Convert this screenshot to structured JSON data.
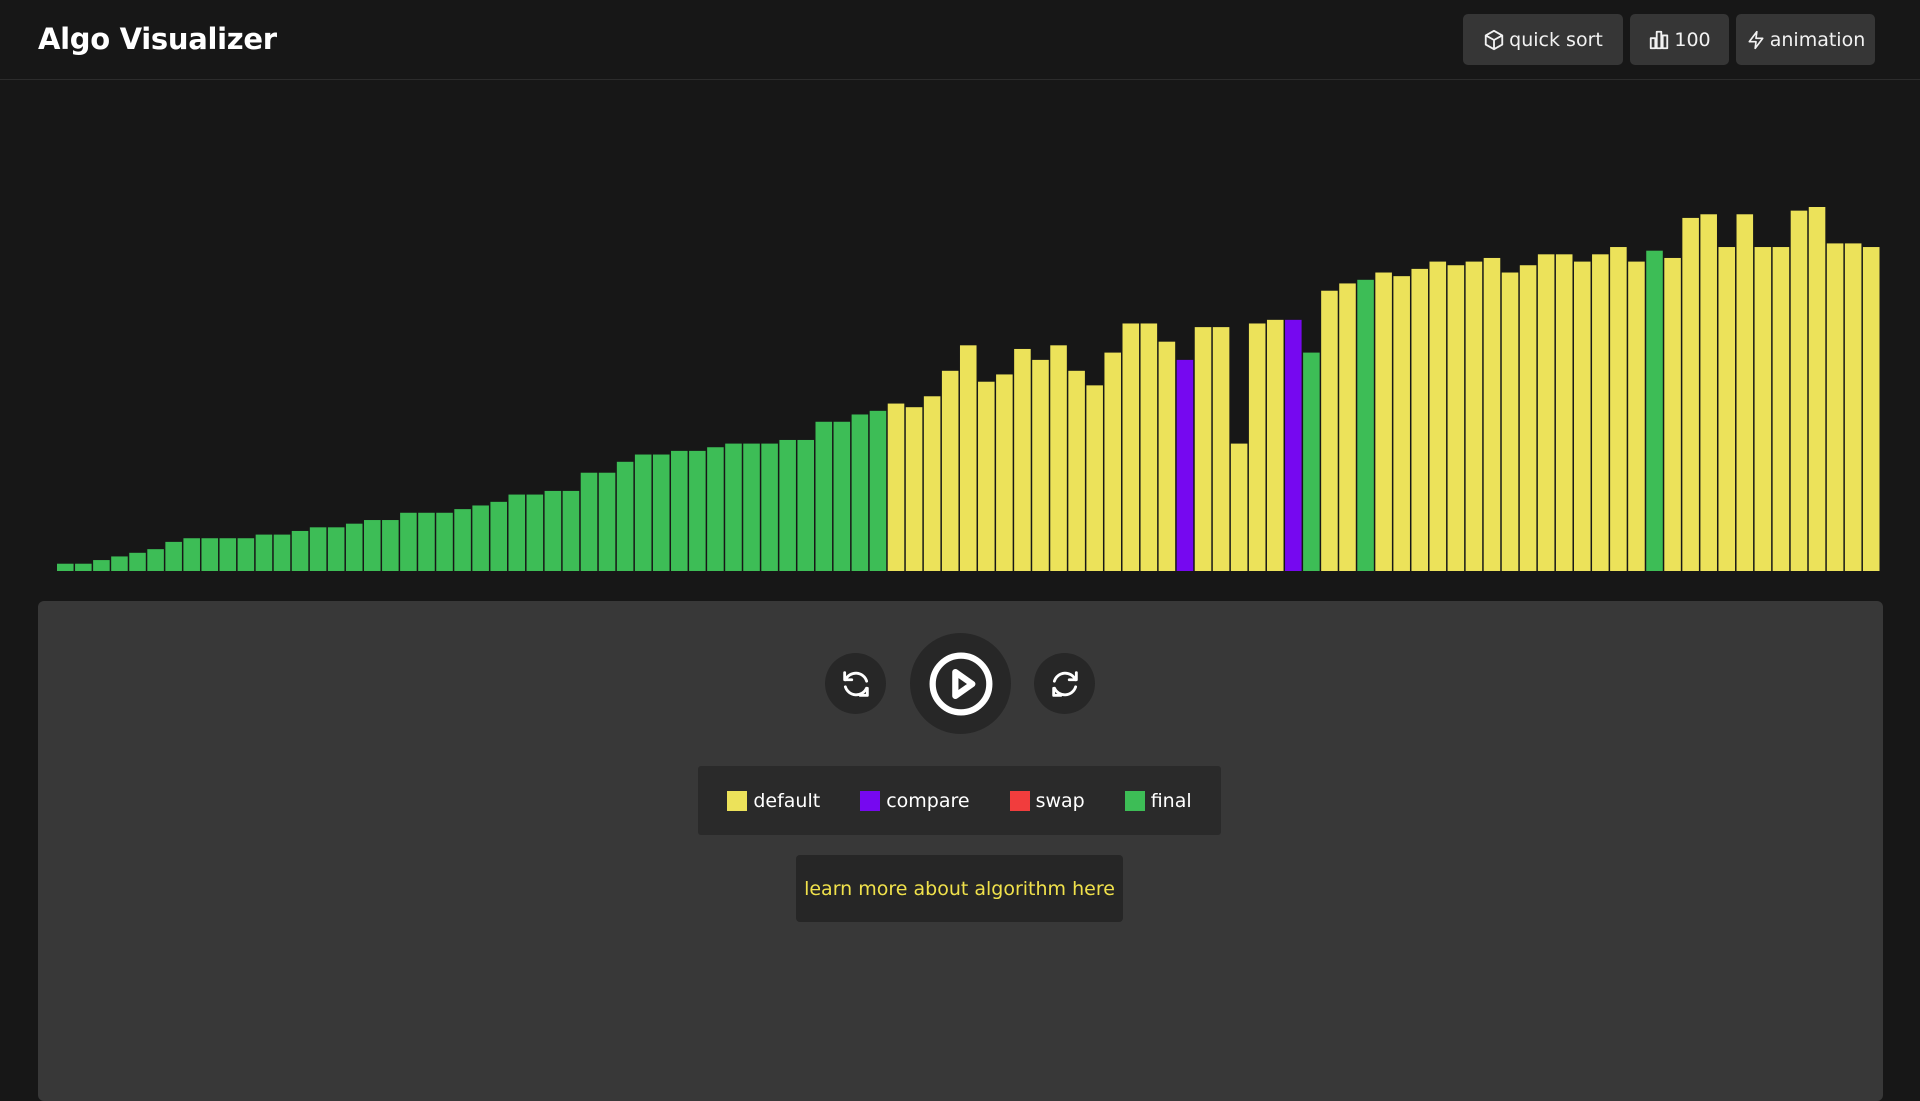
{
  "app": {
    "title": "Algo Visualizer"
  },
  "toolbar": {
    "algorithm_label": "quick sort",
    "algorithm_icon": "cube-icon",
    "array_size_label": "100",
    "array_size_icon": "bar-chart-icon",
    "speed_label": "animation",
    "speed_icon": "lightning-icon"
  },
  "controls": {
    "prev_icon": "rotate-ccw-icon",
    "play_icon": "play-circle-icon",
    "next_icon": "rotate-cw-icon"
  },
  "legend": [
    {
      "label": "default",
      "color": "#ece25a"
    },
    {
      "label": "compare",
      "color": "#7608f0"
    },
    {
      "label": "swap",
      "color": "#f13d3d"
    },
    {
      "label": "final",
      "color": "#3dbd56"
    }
  ],
  "learn_link": "learn more about algorithm here",
  "chart_data": {
    "type": "bar",
    "ylim": [
      0,
      100
    ],
    "values": [
      2,
      2,
      3,
      4,
      5,
      6,
      8,
      9,
      9,
      9,
      9,
      10,
      10,
      11,
      12,
      12,
      13,
      14,
      14,
      16,
      16,
      16,
      17,
      18,
      19,
      21,
      21,
      22,
      22,
      27,
      27,
      30,
      32,
      32,
      33,
      33,
      34,
      35,
      35,
      35,
      36,
      36,
      41,
      41,
      43,
      44,
      46,
      45,
      48,
      55,
      62,
      52,
      54,
      61,
      58,
      62,
      55,
      51,
      60,
      68,
      68,
      63,
      58,
      67,
      67,
      35,
      68,
      69,
      69,
      60,
      77,
      79,
      80,
      82,
      81,
      83,
      85,
      84,
      85,
      86,
      82,
      84,
      87,
      87,
      85,
      87,
      89,
      85,
      88,
      86,
      97,
      98,
      89,
      98,
      89,
      89,
      99,
      100,
      90,
      90,
      89
    ],
    "states": [
      "final",
      "final",
      "final",
      "final",
      "final",
      "final",
      "final",
      "final",
      "final",
      "final",
      "final",
      "final",
      "final",
      "final",
      "final",
      "final",
      "final",
      "final",
      "final",
      "final",
      "final",
      "final",
      "final",
      "final",
      "final",
      "final",
      "final",
      "final",
      "final",
      "final",
      "final",
      "final",
      "final",
      "final",
      "final",
      "final",
      "final",
      "final",
      "final",
      "final",
      "final",
      "final",
      "final",
      "final",
      "final",
      "final",
      "default",
      "default",
      "default",
      "default",
      "default",
      "default",
      "default",
      "default",
      "default",
      "default",
      "default",
      "default",
      "default",
      "default",
      "default",
      "default",
      "compare",
      "default",
      "default",
      "default",
      "default",
      "default",
      "compare",
      "final",
      "default",
      "default",
      "final",
      "default",
      "default",
      "default",
      "default",
      "default",
      "default",
      "default",
      "default",
      "default",
      "default",
      "default",
      "default",
      "default",
      "default",
      "default",
      "final",
      "default",
      "default",
      "default",
      "default",
      "default",
      "default",
      "default",
      "default",
      "default",
      "default",
      "default",
      "default"
    ],
    "colors": {
      "default": "#ece25a",
      "compare": "#7608f0",
      "swap": "#f13d3d",
      "final": "#3dbd56"
    }
  }
}
